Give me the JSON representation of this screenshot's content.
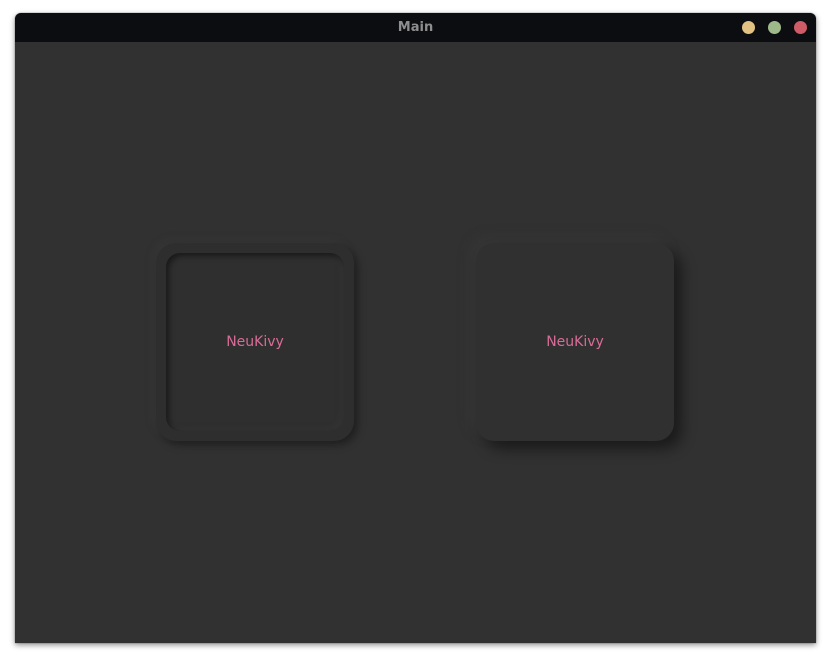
{
  "window": {
    "title": "Main",
    "controls": {
      "minimize_color": "#e2c282",
      "maximize_color": "#9fba8a",
      "close_color": "#cf5b66"
    }
  },
  "cards": [
    {
      "label": "NeuKivy",
      "style": "inset"
    },
    {
      "label": "NeuKivy",
      "style": "raised"
    }
  ],
  "colors": {
    "background": "#313131",
    "titlebar": "#0c0d11",
    "accent_text": "#d86c96"
  }
}
